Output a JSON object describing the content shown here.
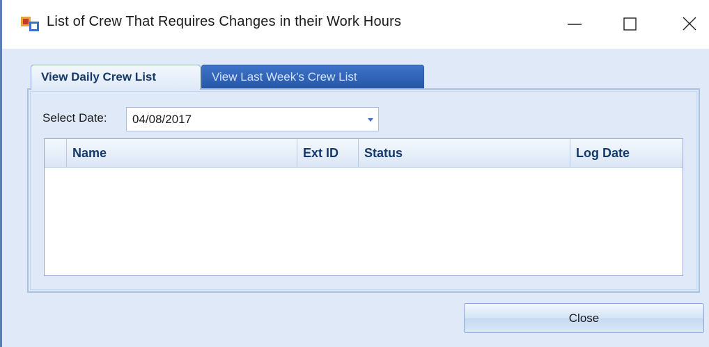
{
  "window": {
    "title": "List of Crew That Requires Changes in their Work Hours",
    "icon": "app-window-icon",
    "controls": [
      "minimize-icon",
      "maximize-icon",
      "close-icon"
    ]
  },
  "tabs": [
    {
      "label": "View Daily Crew List",
      "selected": true
    },
    {
      "label": "View Last Week's Crew List",
      "selected": false
    }
  ],
  "filter": {
    "date_label": "Select Date:",
    "date_value": "04/08/2017"
  },
  "grid": {
    "columns": [
      "Name",
      "Ext ID",
      "Status",
      "Log Date"
    ],
    "rows": []
  },
  "footer": {
    "close_label": "Close"
  },
  "colors": {
    "window_bg": "#dfe9f7",
    "active_tab_text": "#15396b",
    "inactive_tab_bg": "#2757a8"
  }
}
